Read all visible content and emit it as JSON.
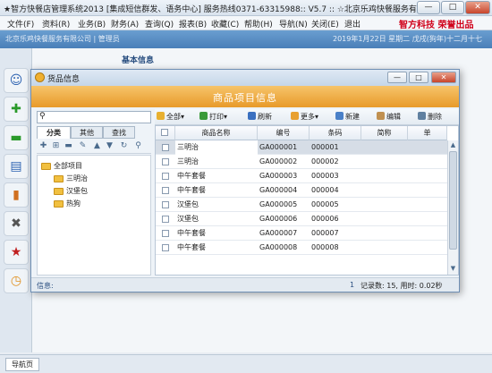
{
  "app": {
    "title": "★智方快餐店管理系统2013 [集成短信群发、语务中心] 服务热线0371-63315988:: V5.7 :: ☆北京乐鸡快餐服务有限公司",
    "min": "—",
    "max": "□",
    "close": "✕"
  },
  "menu": [
    "文件(F)",
    "资料(R)",
    "业务(B)",
    "财务(A)",
    "查询(Q)",
    "报表(B)",
    "收藏(C)",
    "帮助(H)",
    "导航(N)",
    "关闭(E)",
    "退出"
  ],
  "brand": "智方科技 荣誉出品",
  "header": {
    "company": "北京乐鸡快餐服务有限公司 | 管理员",
    "datetime": "2019年1月22日   星期二   戊戌(狗年)十二月十七"
  },
  "basic_info": "基本信息",
  "bottom": {
    "nav_page": "导航页"
  },
  "dialog": {
    "title": "货品信息",
    "banner": "商品项目信息",
    "min": "—",
    "max": "□",
    "close": "✕",
    "left_tabs": [
      "分类",
      "其他",
      "查找"
    ],
    "tree": {
      "root": "全部项目",
      "children": [
        "三明治",
        "汉堡包",
        "热狗"
      ]
    },
    "toolbar": [
      "全部",
      "打印",
      "刷新",
      "更多",
      "新建",
      "编辑",
      "删除"
    ],
    "columns": [
      "商品名称",
      "编号",
      "条码",
      "简称",
      "单"
    ],
    "rows": [
      {
        "name": "三明治",
        "code": "GA000001",
        "barcode": "000001"
      },
      {
        "name": "三明治",
        "code": "GA000002",
        "barcode": "000002"
      },
      {
        "name": "中午套餐",
        "code": "GA000003",
        "barcode": "000003"
      },
      {
        "name": "中午套餐",
        "code": "GA000004",
        "barcode": "000004"
      },
      {
        "name": "汉堡包",
        "code": "GA000005",
        "barcode": "000005"
      },
      {
        "name": "汉堡包",
        "code": "GA000006",
        "barcode": "000006"
      },
      {
        "name": "中午套餐",
        "code": "GA000007",
        "barcode": "000007"
      },
      {
        "name": "中午套餐",
        "code": "GA000008",
        "barcode": "000008"
      }
    ],
    "status": {
      "label": "信息:",
      "page": "1",
      "info": "记录数: 15,  用时: 0.02秒"
    }
  }
}
